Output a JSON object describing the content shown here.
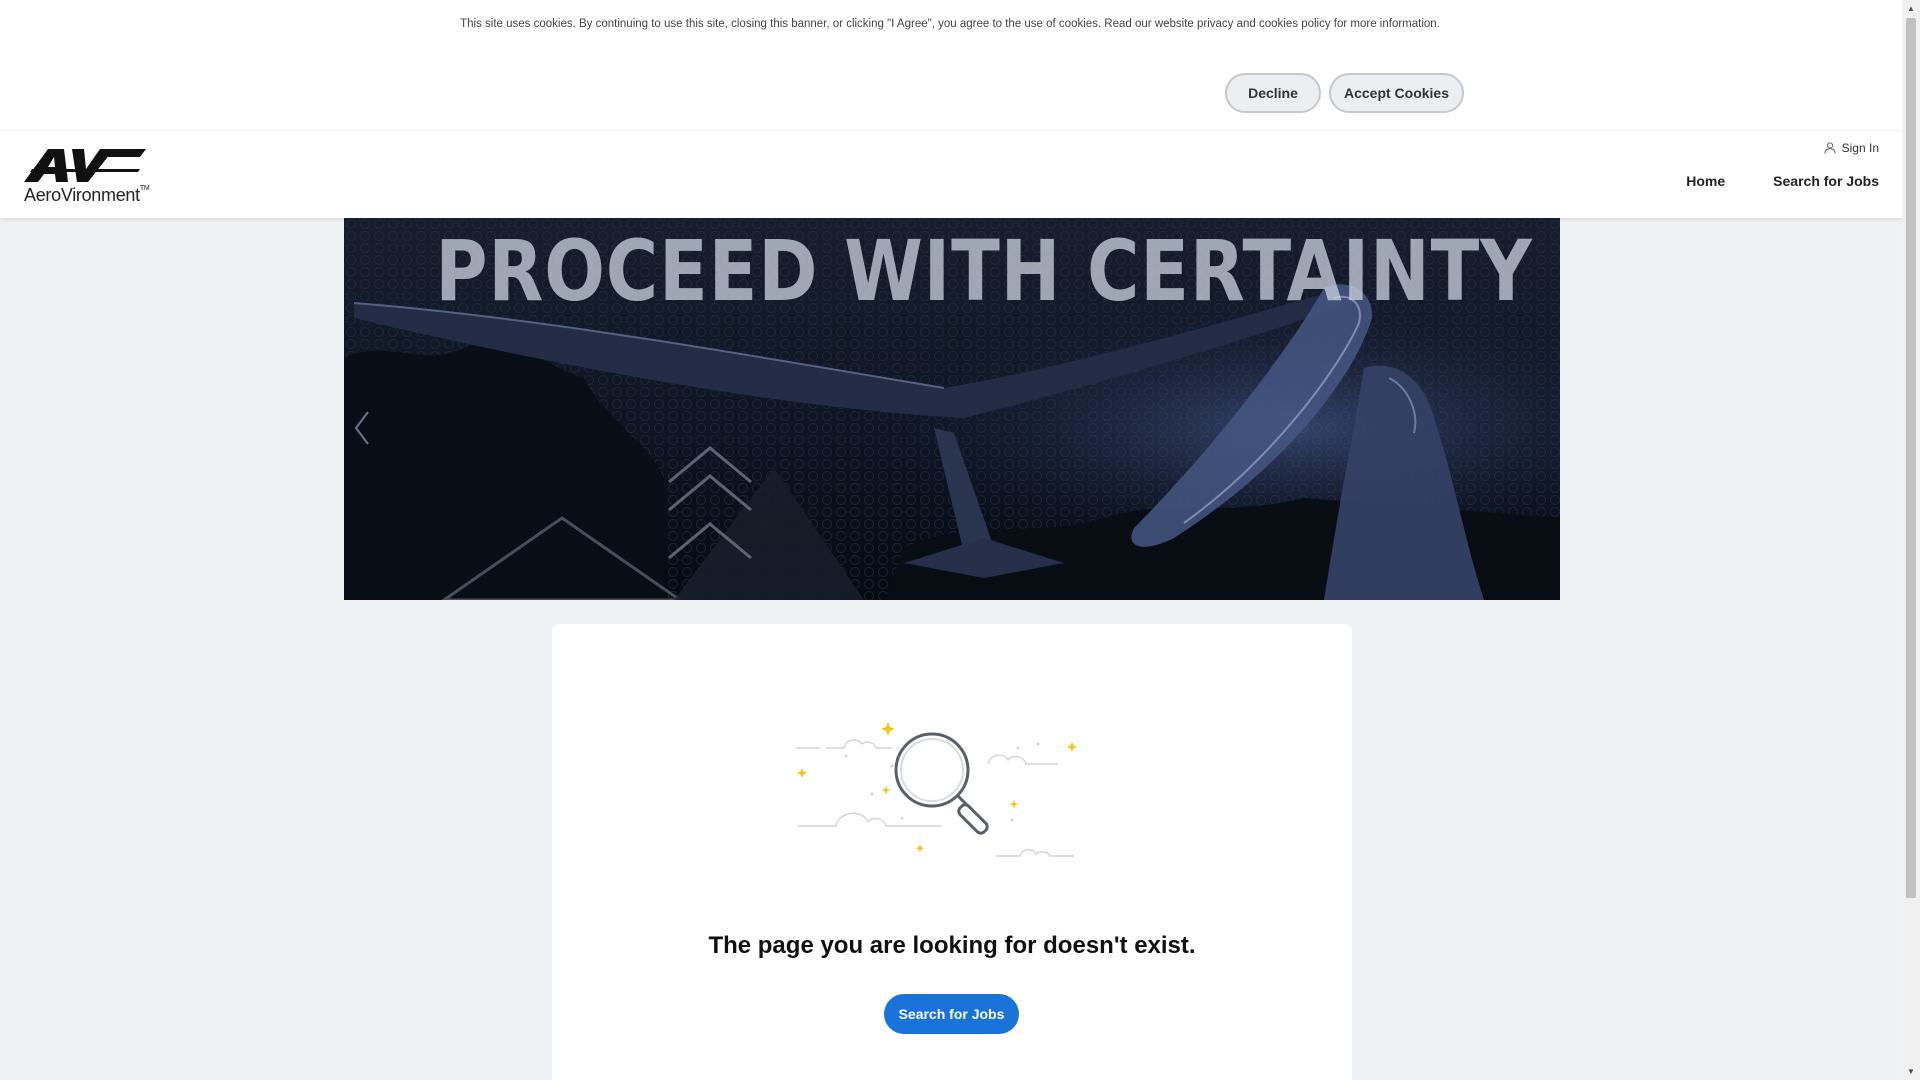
{
  "cookie_banner": {
    "text": "This site uses cookies. By continuing to use this site, closing this banner, or clicking \"I Agree\", you agree to the use of cookies. Read our website privacy and cookies policy for more information.",
    "decline_label": "Decline",
    "accept_label": "Accept Cookies"
  },
  "header": {
    "brand": "AeroVironment",
    "brand_mark": "TM",
    "sign_in": "Sign In",
    "nav": [
      {
        "label": "Home"
      },
      {
        "label": "Search for Jobs"
      }
    ]
  },
  "hero": {
    "headline": "PROCEED WITH CERTAINTY"
  },
  "error_card": {
    "message": "The page you are looking for doesn't exist.",
    "button_label": "Search for Jobs"
  },
  "colors": {
    "primary_button": "#1a73d9",
    "page_background": "#f0f1f3",
    "illustration_star": "#f5c518"
  },
  "icons": [
    "user-icon",
    "chevron-left-icon",
    "magnifier-icon",
    "scroll-up-icon",
    "scroll-down-icon"
  ]
}
